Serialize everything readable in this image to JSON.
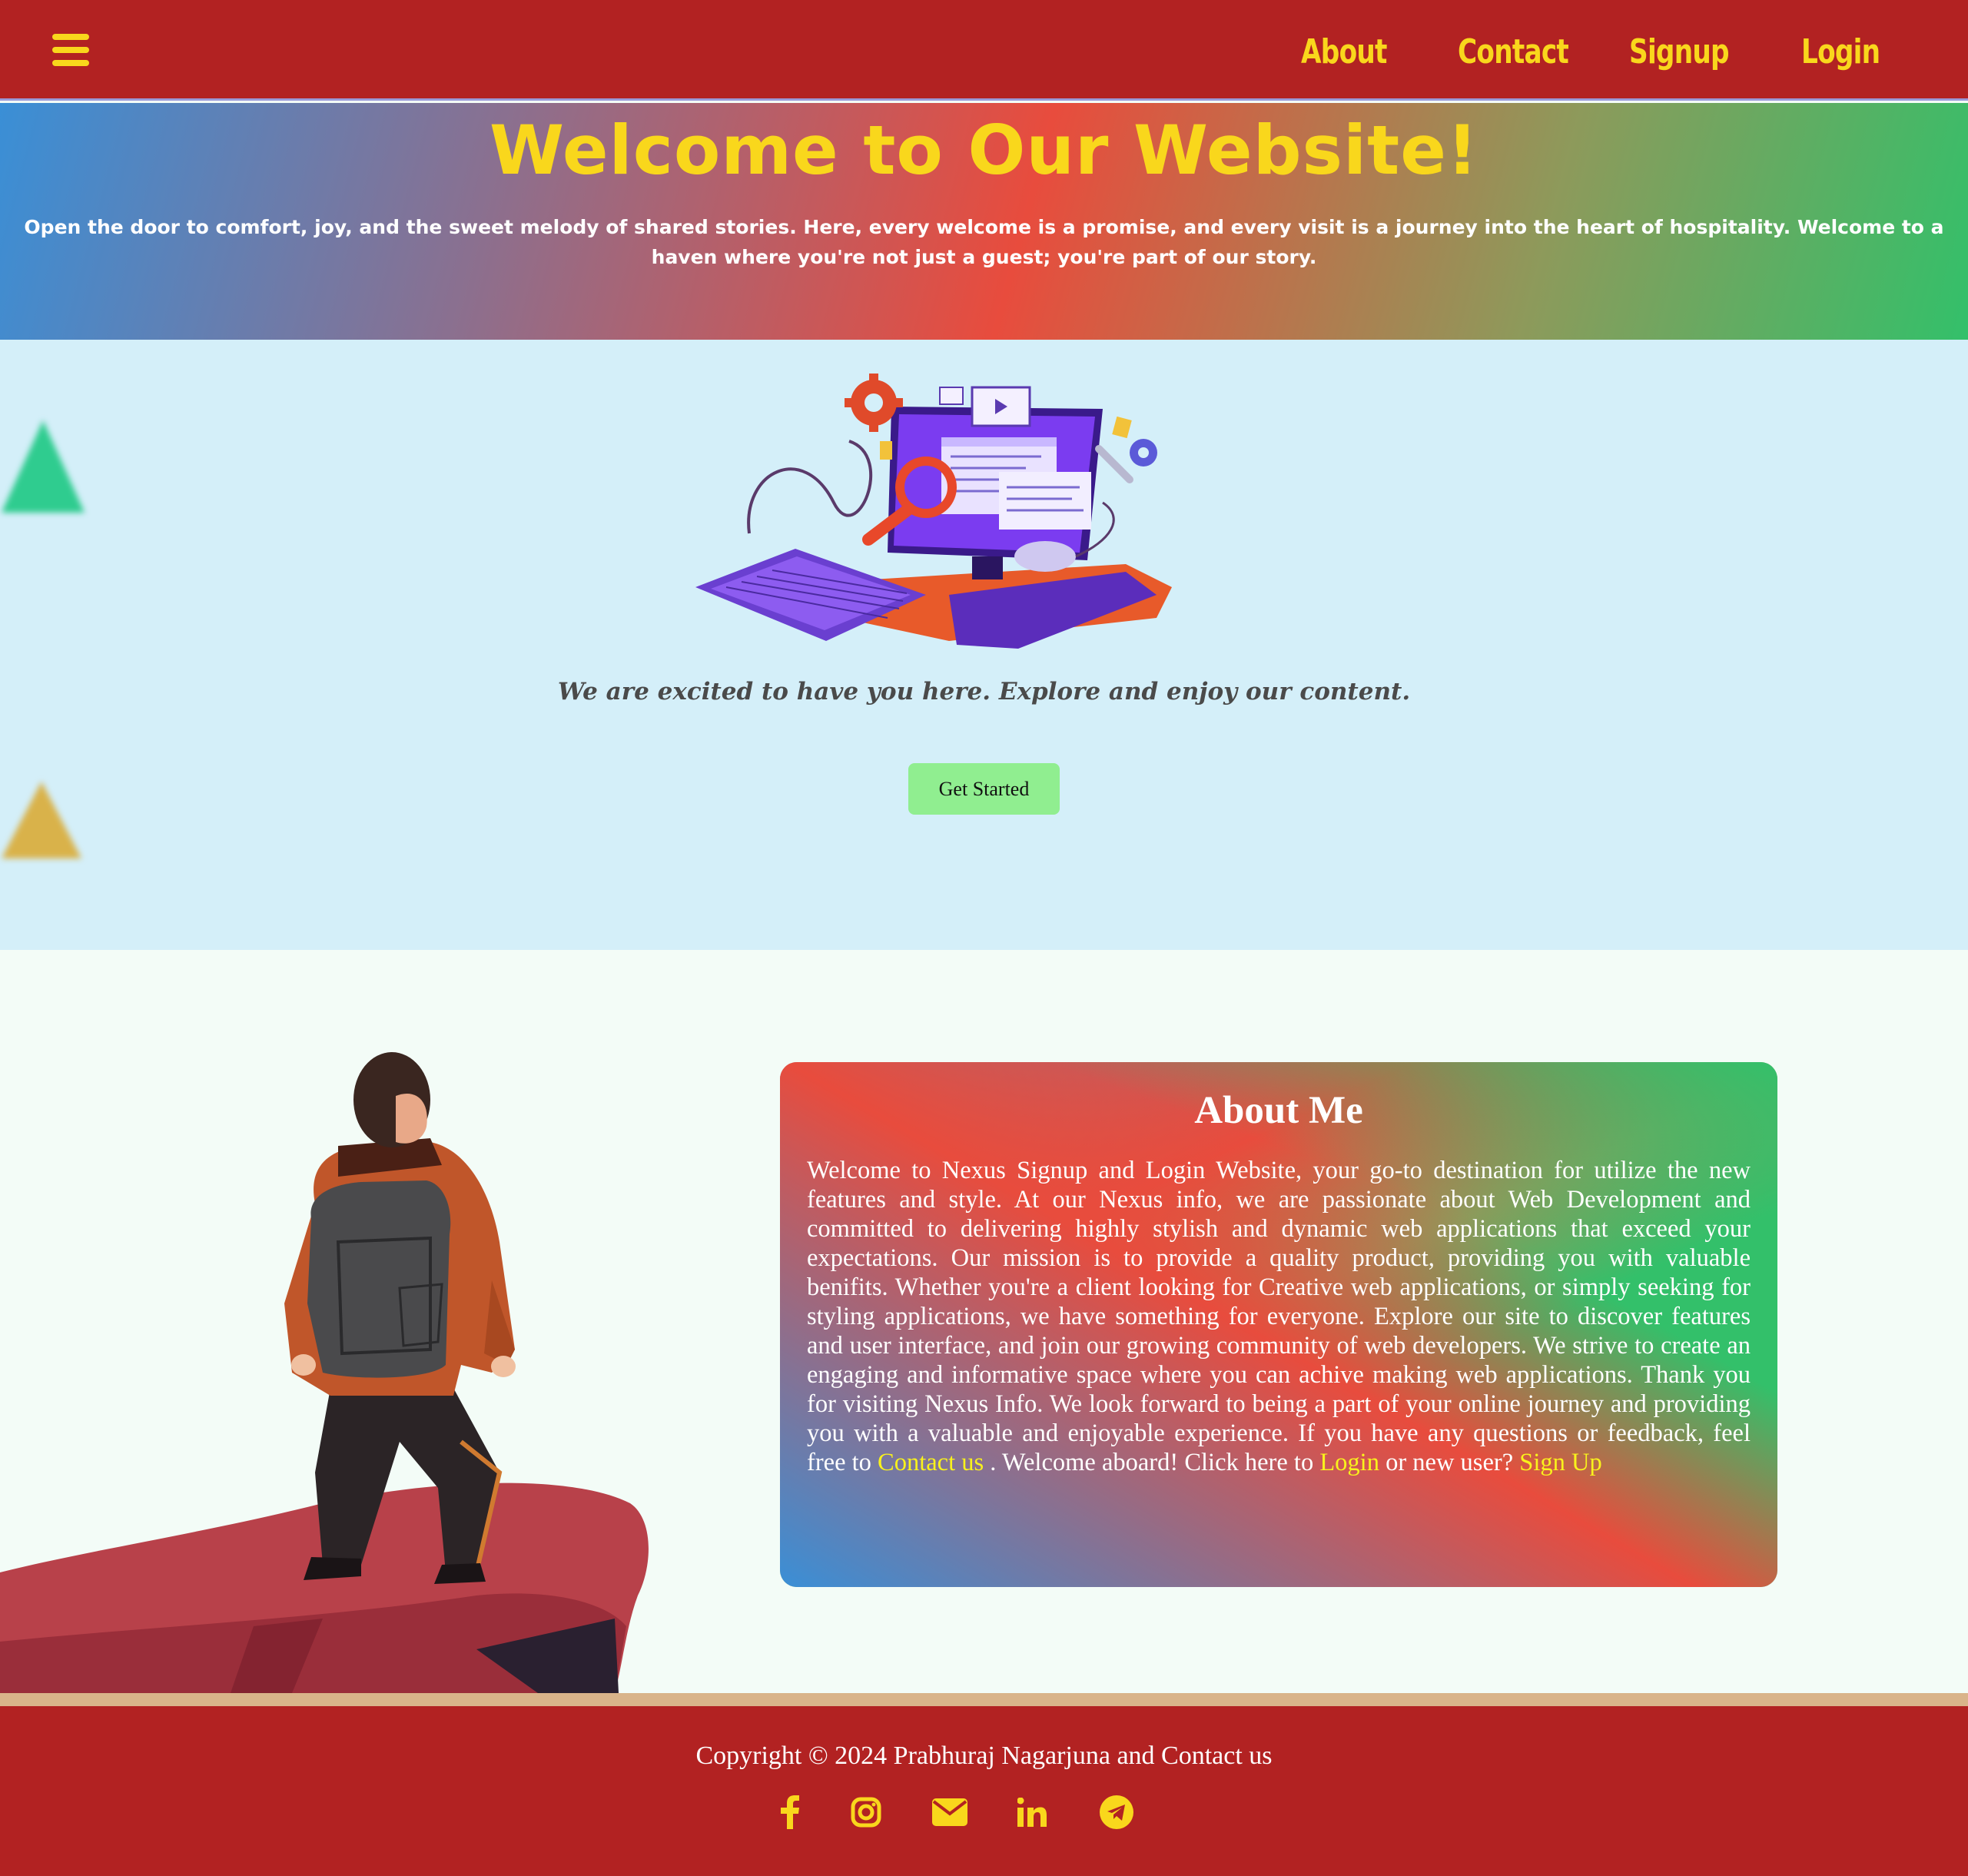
{
  "nav": {
    "menu_icon": "hamburger-menu-icon",
    "links": [
      "About",
      "Contact",
      "Signup",
      "Login"
    ]
  },
  "hero": {
    "title": "Welcome to Our Website!",
    "text": "Open the door to comfort, joy, and the sweet melody of shared stories. Here, every welcome is a promise, and every visit is a journey into the heart of hospitality. Welcome to a haven where you're not just a guest; you're part of our story."
  },
  "welcome": {
    "message": "We are excited to have you here. Explore and enjoy our content.",
    "button": "Get Started"
  },
  "about": {
    "title": "About Me",
    "text_part1": "Welcome to Nexus Signup and Login Website, your go-to destination for utilize the new features and style. At our Nexus info, we are passionate about Web Development and committed to delivering highly stylish and dynamic web applications that exceed your expectations. Our mission is to provide a quality product, providing you with valuable benifits. Whether you're a client looking for Creative web applications, or simply seeking for styling applications, we have something for everyone. Explore our site to discover features and user interface, and join our growing community of web developers. We strive to create an engaging and informative space where you can achive making web applications. Thank you for visiting Nexus Info. We look forward to being a part of your online journey and providing you with a valuable and enjoyable experience. If you have any questions or feedback, feel free to",
    "link_contact": "Contact us",
    "text_part2": ". Welcome aboard! Click here to",
    "link_login": "Login",
    "text_part3": "or new user?",
    "link_signup": "Sign Up"
  },
  "footer": {
    "copyright": "Copyright © 2024 Prabhuraj Nagarjuna and Contact us",
    "social_icons": [
      "facebook-icon",
      "instagram-icon",
      "email-icon",
      "linkedin-icon",
      "telegram-icon"
    ]
  },
  "colors": {
    "nav_bg": "#b22222",
    "accent_yellow": "#f9d71c",
    "welcome_bg": "#d4eff9",
    "button_green": "#90ee90",
    "link_yellow": "#f9f21c"
  }
}
